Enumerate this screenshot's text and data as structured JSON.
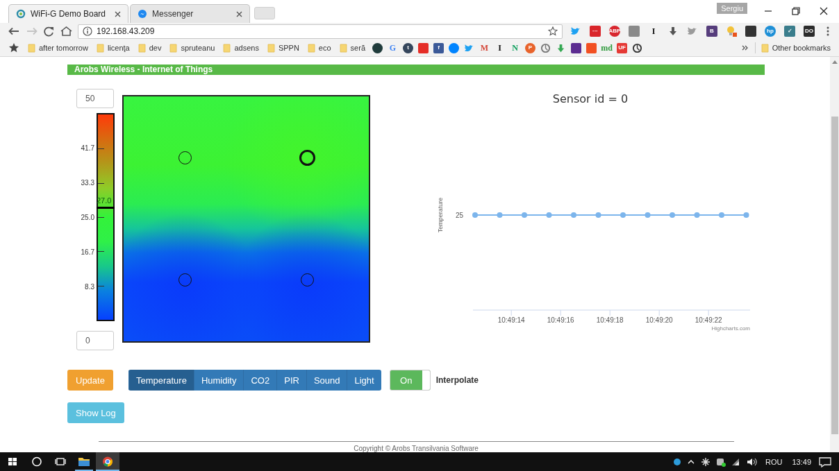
{
  "browser": {
    "tabs": [
      {
        "title": "WiFi-G Demo Board",
        "kind": "ring",
        "selected": true
      },
      {
        "title": "Messenger",
        "kind": "bubble",
        "selected": false
      }
    ],
    "profile": "Sergiu",
    "forward_disabled": true,
    "address": "192.168.43.209",
    "extensions": [
      {
        "kind": "bird",
        "color": "#1da1f2"
      },
      {
        "kind": "square",
        "color": "#d9252a",
        "label": "···"
      },
      {
        "kind": "circle",
        "color": "#d8262e",
        "label": "ABP"
      },
      {
        "kind": "square",
        "color": "#8a8a8a"
      },
      {
        "kind": "letter",
        "color": "#111111",
        "label": "I"
      },
      {
        "kind": "arrow",
        "color": "#555555"
      },
      {
        "kind": "bird",
        "color": "#9a9a9a"
      },
      {
        "kind": "square",
        "color": "#563d7c",
        "label": "B"
      },
      {
        "kind": "bulb",
        "color": "#f2c23a"
      },
      {
        "kind": "square",
        "color": "#333333"
      },
      {
        "kind": "circle",
        "color": "#1e8fd6",
        "label": "hp"
      },
      {
        "kind": "square",
        "color": "#3a7d8c",
        "label": "✓"
      },
      {
        "kind": "square",
        "color": "#2b2b2b",
        "label": "DO"
      }
    ],
    "bookmark_folders": [
      "after tomorrow",
      "licenţa",
      "dev",
      "spruteanu",
      "adsens",
      "SPPN",
      "eco",
      "seră"
    ],
    "bookmark_icons": [
      {
        "kind": "circle",
        "color": "#1f3b3b"
      },
      {
        "kind": "letter",
        "color": "#4285f4",
        "label": "G"
      },
      {
        "kind": "circle",
        "color": "#35465c",
        "label": "t"
      },
      {
        "kind": "square",
        "color": "#e52d27"
      },
      {
        "kind": "square",
        "color": "#3b5998",
        "label": "f"
      },
      {
        "kind": "circle",
        "color": "#0084ff"
      },
      {
        "kind": "bird",
        "color": "#1da1f2"
      },
      {
        "kind": "letter",
        "color": "#d44638",
        "label": "M"
      },
      {
        "kind": "letter",
        "color": "#111111",
        "label": "I"
      },
      {
        "kind": "letter",
        "color": "#0a9e5a",
        "label": "N"
      },
      {
        "kind": "circle",
        "color": "#e8632b",
        "label": "P"
      },
      {
        "kind": "ring",
        "color": "#777777"
      },
      {
        "kind": "arrow",
        "color": "#34a853"
      },
      {
        "kind": "square",
        "color": "#5c2d91"
      },
      {
        "kind": "square",
        "color": "#f25022"
      },
      {
        "kind": "letter",
        "color": "#2e9a3c",
        "label": "md"
      },
      {
        "kind": "square",
        "color": "#e53935",
        "label": "UF"
      },
      {
        "kind": "ring",
        "color": "#333333"
      }
    ],
    "other_bookmarks": "Other bookmarks"
  },
  "page": {
    "header": "Arobs Wireless - Internet of Things",
    "scale": {
      "max": "50",
      "min": "0",
      "ticks": [
        "41.7",
        "33.3",
        "25.0",
        "16.7",
        "8.3"
      ],
      "marker": {
        "label": "27.0",
        "level": 0.54
      }
    },
    "sensors": [
      {
        "selected": false
      },
      {
        "selected": true
      },
      {
        "selected": false
      },
      {
        "selected": false
      }
    ],
    "chart": {
      "title": "Sensor id = 0",
      "axis_title": "Temperature",
      "y_label": "25",
      "x_labels": [
        "10:49:14",
        "10:49:16",
        "10:49:18",
        "10:49:20",
        "10:49:22"
      ],
      "credits": "Highcharts.com"
    },
    "update_button": "Update",
    "modes": [
      {
        "label": "Temperature",
        "selected": true
      },
      {
        "label": "Humidity",
        "selected": false
      },
      {
        "label": "CO2",
        "selected": false
      },
      {
        "label": "PIR",
        "selected": false
      },
      {
        "label": "Sound",
        "selected": false
      },
      {
        "label": "Light",
        "selected": false
      }
    ],
    "toggle": {
      "label": "On",
      "on": true
    },
    "interpolate_label": "Interpolate",
    "show_log_button": "Show Log",
    "footer": "Copyright © Arobs Transilvania Software"
  },
  "taskbar": {
    "language": "ROU",
    "time": "13:49"
  }
}
